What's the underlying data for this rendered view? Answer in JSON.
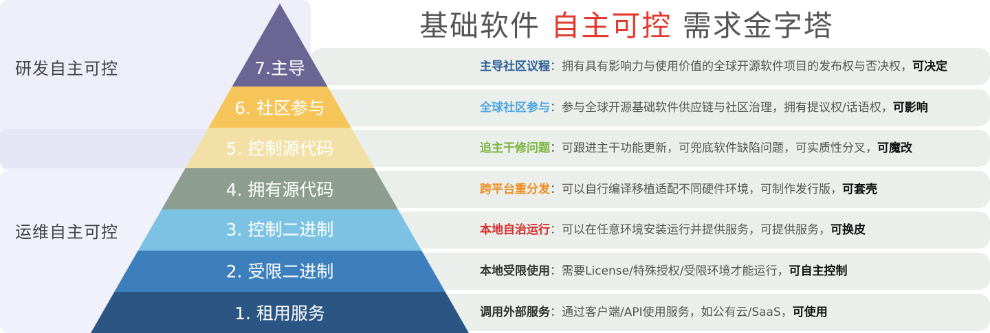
{
  "title": {
    "prefix": "基础软件 ",
    "highlight": "自主可控",
    "suffix": " 需求金字塔"
  },
  "zones": {
    "top": "研发自主可控",
    "bottom": "运维自主可控"
  },
  "tiers": [
    {
      "level": "7.主导",
      "color": "#6b6594",
      "label_color": "#ffffff",
      "title": "主导社区议程",
      "title_color": "#2e5f96",
      "desc": "拥有具有影响力与使用价值的全球开源软件项目的发布权与否决权，",
      "capability": "可决定"
    },
    {
      "level": "6. 社区参与",
      "color": "#f5c55a",
      "label_color": "#ffffff",
      "title": "全球社区参与",
      "title_color": "#4fa6e0",
      "desc": "参与全球开源基础软件供应链与社区治理，拥有提议权/话语权，",
      "capability": "可影响"
    },
    {
      "level": "5. 控制源代码",
      "color": "#f2e0a6",
      "label_color": "#ffffff",
      "title": "追主干修问题",
      "title_color": "#7cb342",
      "desc": "可跟进主干功能更新，可兜底软件缺陷问题，可实质性分叉，",
      "capability": "可魔改"
    },
    {
      "level": "4. 拥有源代码",
      "color": "#8d9d8f",
      "label_color": "#ffffff",
      "title": "跨平台重分发",
      "title_color": "#ef8c1e",
      "desc": "可以自行编译移植适配不同硬件环境，可制作发行版，",
      "capability": "可套壳"
    },
    {
      "level": "3. 控制二进制",
      "color": "#7cc3e3",
      "label_color": "#ffffff",
      "title": "本地自治运行",
      "title_color": "#d32f2f",
      "desc": "可以在任意环境安装运行并提供服务，可提供服务，",
      "capability": "可换皮"
    },
    {
      "level": "2. 受限二进制",
      "color": "#3d7fbd",
      "label_color": "#ffffff",
      "title": "本地受限使用",
      "title_color": "#333333",
      "desc": "需要License/特殊授权/受限环境才能运行，",
      "capability": "可自主控制"
    },
    {
      "level": "1. 租用服务",
      "color": "#2b5683",
      "label_color": "#ffffff",
      "title": "调用外部服务",
      "title_color": "#333333",
      "desc": "通过客户端/API使用服务，如公有云/SaaS，",
      "capability": "可使用"
    }
  ]
}
